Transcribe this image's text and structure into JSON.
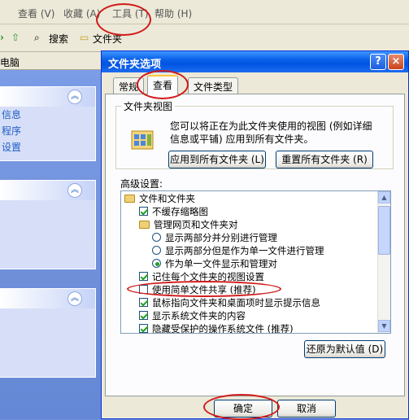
{
  "explorer": {
    "menu": [
      "查看 (V)",
      "收藏 (A)",
      "工具 (T)",
      "帮助 (H)"
    ],
    "toolbar": {
      "search": "搜索",
      "folders": "文件夹"
    },
    "address_fragment": "电脑",
    "left_tasks": [
      "信息",
      "程序",
      "设置"
    ]
  },
  "dialog": {
    "title": "文件夹选项",
    "help": "?",
    "close": "×",
    "tabs": [
      "常规",
      "查看",
      "文件类型"
    ],
    "folder_views": {
      "legend": "文件夹视图",
      "description": "您可以将正在为此文件夹使用的视图 (例如详细信息或平铺) 应用到所有文件夹。",
      "apply_button": "应用到所有文件夹 (L)",
      "reset_button": "重置所有文件夹 (R)"
    },
    "advanced_label": "高级设置:",
    "advanced_items": [
      {
        "type": "folder",
        "label": "文件和文件夹"
      },
      {
        "type": "checkbox",
        "checked": true,
        "label": "不缓存缩略图"
      },
      {
        "type": "folder",
        "label": "管理网页和文件夹对"
      },
      {
        "type": "radio",
        "checked": false,
        "label": "显示两部分并分别进行管理"
      },
      {
        "type": "radio",
        "checked": false,
        "label": "显示两部分但是作为单一文件进行管理"
      },
      {
        "type": "radio",
        "checked": true,
        "label": "作为单一文件显示和管理对"
      },
      {
        "type": "checkbox",
        "checked": true,
        "label": "记住每个文件夹的视图设置"
      },
      {
        "type": "checkbox",
        "checked": false,
        "label": "使用简单文件共享 (推荐)"
      },
      {
        "type": "checkbox",
        "checked": true,
        "label": "鼠标指向文件夹和桌面项时显示提示信息"
      },
      {
        "type": "checkbox",
        "checked": true,
        "label": "显示系统文件夹的内容"
      },
      {
        "type": "checkbox",
        "checked": true,
        "label": "隐藏受保护的操作系统文件 (推荐)"
      }
    ],
    "restore_button": "还原为默认值 (D)",
    "ok_button": "确定",
    "cancel_button": "取消"
  },
  "colors": {
    "title_blue": "#0054e3",
    "annotation_red": "#d11a1a",
    "check_green": "#21a121"
  }
}
